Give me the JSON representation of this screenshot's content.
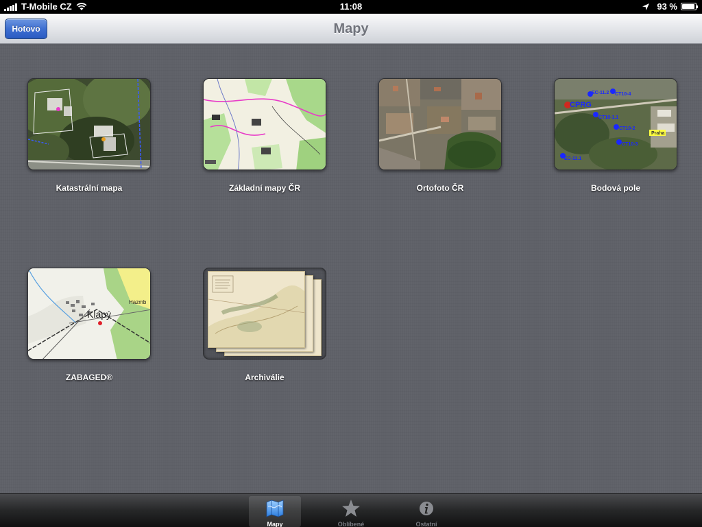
{
  "status_bar": {
    "carrier": "T-Mobile CZ",
    "time": "11:08",
    "battery": "93 %",
    "battery_level": 0.93
  },
  "nav_bar": {
    "title": "Mapy",
    "done_label": "Hotovo"
  },
  "maps": [
    {
      "label": "Katastrální mapa"
    },
    {
      "label": "Základní mapy ČR"
    },
    {
      "label": "Ortofoto ČR"
    },
    {
      "label": "Bodová pole",
      "points": [
        "CPRG",
        "EC-11.2",
        "CT10-4",
        "CT10-1.1",
        "CT10-2",
        "CT10-3",
        "EC-11.1"
      ],
      "place": "Praha"
    },
    {
      "label": "ZABAGED®",
      "place": "Klapý",
      "place2": "Hazmb"
    },
    {
      "label": "Archiválie"
    }
  ],
  "tab_bar": {
    "tabs": [
      {
        "label": "Mapy",
        "icon": "map-icon",
        "active": true
      },
      {
        "label": "Oblíbené",
        "icon": "star-icon",
        "active": false
      },
      {
        "label": "Ostatní",
        "icon": "info-icon",
        "active": false
      }
    ]
  },
  "colors": {
    "accent": "#3e6fd1",
    "background": "#5f6168",
    "cadastral_line": "#3a5bff",
    "boundary_pink": "#e83cc8"
  }
}
